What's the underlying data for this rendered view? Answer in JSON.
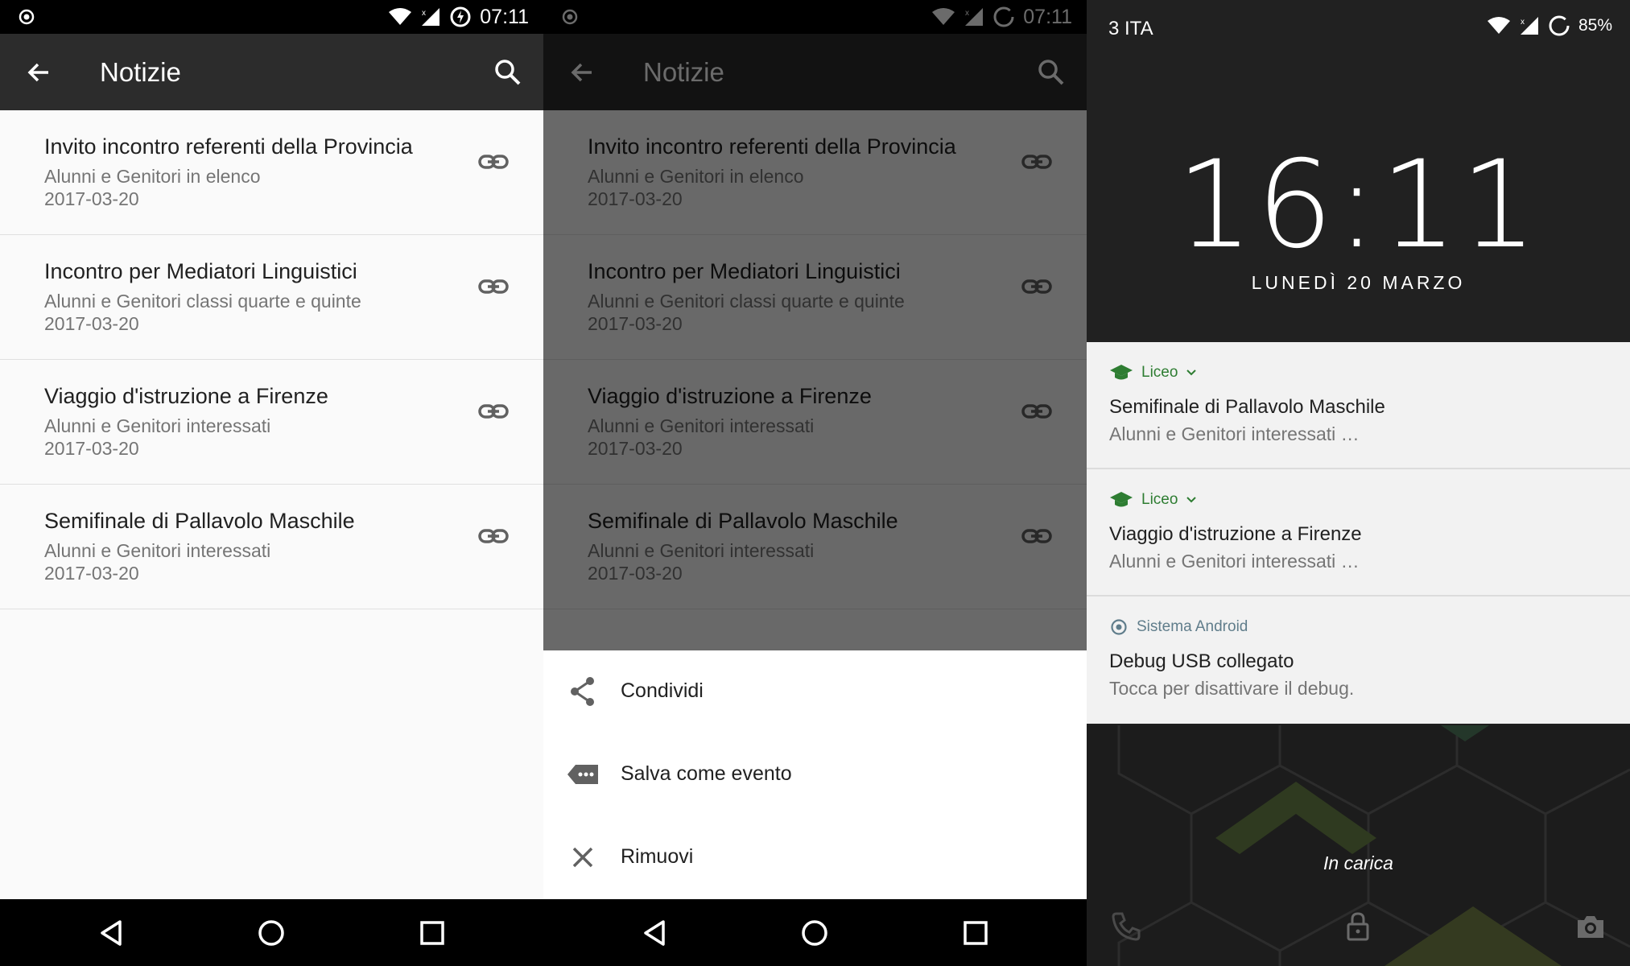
{
  "status_bar": {
    "time": "07:11"
  },
  "app": {
    "title": "Notizie"
  },
  "news_items": [
    {
      "title": "Invito incontro referenti della Provincia",
      "audience": "Alunni e Genitori in elenco",
      "date": "2017-03-20"
    },
    {
      "title": "Incontro per Mediatori Linguistici",
      "audience": "Alunni e Genitori classi quarte e quinte",
      "date": "2017-03-20"
    },
    {
      "title": "Viaggio d'istruzione a Firenze",
      "audience": "Alunni e Genitori interessati",
      "date": "2017-03-20"
    },
    {
      "title": "Semifinale di Pallavolo Maschile",
      "audience": "Alunni e Genitori interessati",
      "date": "2017-03-20"
    }
  ],
  "bottom_sheet": {
    "share": "Condividi",
    "save_event": "Salva come evento",
    "remove": "Rimuovi"
  },
  "lockscreen": {
    "carrier": "3 ITA",
    "battery": "85%",
    "clock": "16:11",
    "date": "LUNEDÌ 20 MARZO",
    "charging": "In carica",
    "notifications": [
      {
        "app": "Liceo",
        "title": "Semifinale di Pallavolo Maschile",
        "text": "Alunni e Genitori interessati …"
      },
      {
        "app": "Liceo",
        "title": "Viaggio d'istruzione a Firenze",
        "text": "Alunni e Genitori interessati …"
      },
      {
        "app": "Sistema Android",
        "title": "Debug USB collegato",
        "text": "Tocca per disattivare il debug."
      }
    ]
  },
  "colors": {
    "appbar": "#2c2c2c",
    "notification_app": "#2e7d32",
    "list_bg": "#fafafa"
  },
  "icons": [
    "back-arrow-icon",
    "search-icon",
    "link-icon",
    "share-icon",
    "event-label-icon",
    "close-icon",
    "nav-back-icon",
    "nav-home-icon",
    "nav-recents-icon",
    "school-cap-icon",
    "phone-icon",
    "lock-icon",
    "camera-icon",
    "wifi-icon",
    "signal-icon",
    "battery-icon"
  ]
}
